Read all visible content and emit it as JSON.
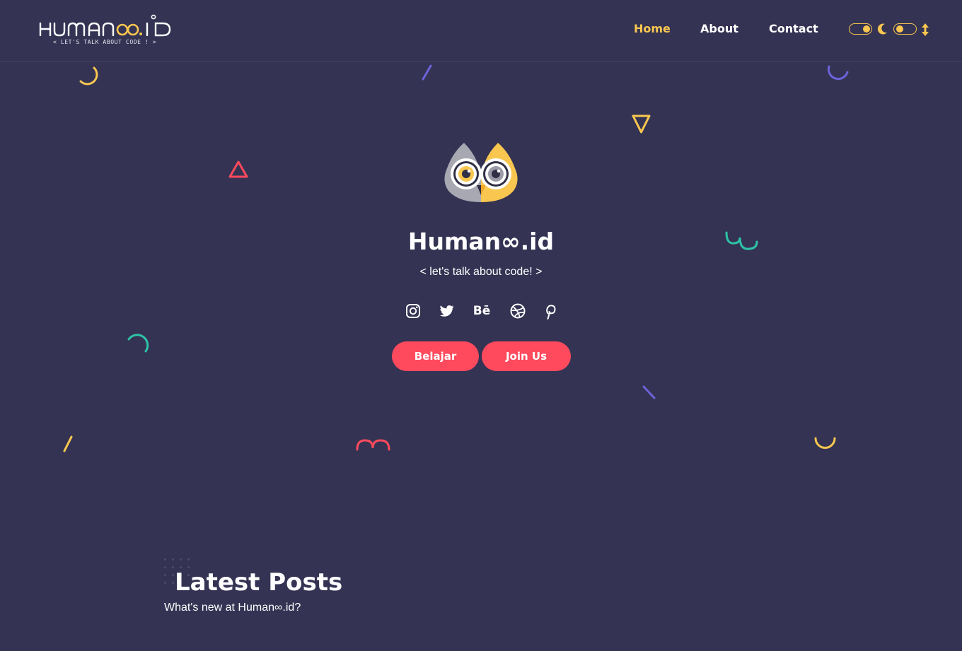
{
  "logo": {
    "wordmark": "HUMAN∞.ID",
    "tagline": "< let's talk about code ! >"
  },
  "nav": {
    "items": [
      {
        "label": "Home",
        "active": true
      },
      {
        "label": "About",
        "active": false
      },
      {
        "label": "Contact",
        "active": false
      }
    ]
  },
  "toggles": {
    "theme_toggle_icon": "moon-icon",
    "scroll_toggle_icon": "up-down-arrow-icon"
  },
  "hero": {
    "title": "Human∞.id",
    "tagline": "< let's talk about code! >",
    "socials": [
      {
        "name": "instagram-icon"
      },
      {
        "name": "twitter-icon"
      },
      {
        "name": "behance-icon",
        "label": "Bē"
      },
      {
        "name": "dribbble-icon"
      },
      {
        "name": "pinterest-icon"
      }
    ],
    "buttons": {
      "primary": "Belajar",
      "secondary": "Join Us"
    }
  },
  "latest": {
    "title": "Latest Posts",
    "subtitle": "What's new at Human∞.id?"
  },
  "colors": {
    "background": "#343353",
    "accent_yellow": "#f9c74f",
    "accent_red": "#ff4a5e",
    "accent_purple": "#6c63d9",
    "accent_teal": "#2ec4a7"
  }
}
